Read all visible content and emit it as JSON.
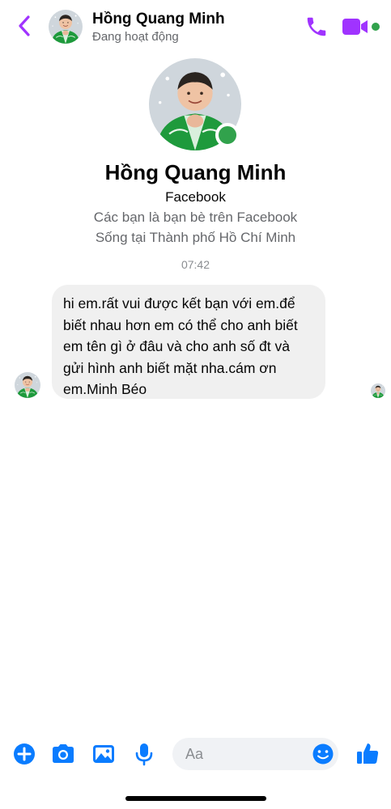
{
  "header": {
    "name": "Hồng Quang Minh",
    "status": "Đang hoạt động"
  },
  "profile": {
    "name": "Hồng Quang Minh",
    "network": "Facebook",
    "friendship": "Các bạn là bạn bè trên Facebook",
    "location": "Sống tại Thành phố Hồ Chí Minh"
  },
  "conversation": {
    "timestamp": "07:42",
    "message": "hi em.rất vui được kết bạn với em.để biết nhau hơn em có thể cho anh biết em tên gì ở đâu và cho anh số đt và gửi hình anh biết mặt nha.cám ơn em.Minh Béo"
  },
  "composer": {
    "placeholder": "Aa"
  },
  "colors": {
    "accent": "#a033ff",
    "online": "#31a24c",
    "messenger_blue": "#0a7cff",
    "bubble_gray": "#f0f0f0",
    "secondary_text": "#65676b",
    "avatar_green": "#1e9a3c"
  },
  "icons": {
    "back": "chevron-left-icon",
    "call": "phone-icon",
    "video": "video-camera-icon",
    "plus": "plus-circle-icon",
    "camera": "camera-icon",
    "image": "image-icon",
    "mic": "microphone-icon",
    "emoji": "smiley-icon",
    "like": "thumbs-up-icon"
  }
}
